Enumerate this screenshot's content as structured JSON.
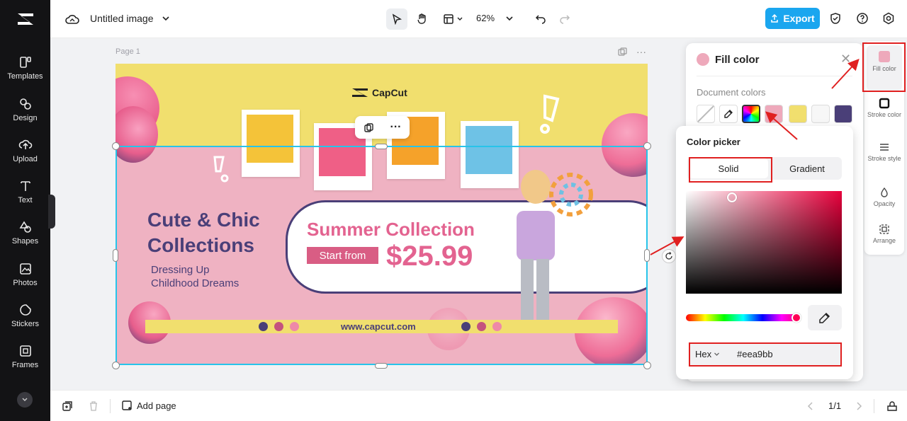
{
  "app": {
    "doc_title": "Untitled image",
    "zoom": "62%",
    "export_label": "Export",
    "add_page_label": "Add page",
    "page_count": "1/1",
    "page_label": "Page 1"
  },
  "sidebar": {
    "items": [
      {
        "label": "Templates",
        "icon": "templates-icon"
      },
      {
        "label": "Design",
        "icon": "design-icon"
      },
      {
        "label": "Upload",
        "icon": "upload-icon"
      },
      {
        "label": "Text",
        "icon": "text-icon"
      },
      {
        "label": "Shapes",
        "icon": "shapes-icon"
      },
      {
        "label": "Photos",
        "icon": "photos-icon"
      },
      {
        "label": "Stickers",
        "icon": "stickers-icon"
      },
      {
        "label": "Frames",
        "icon": "frames-icon"
      }
    ]
  },
  "design": {
    "brand": "CapCut",
    "title_line1": "Cute & Chic",
    "title_line2": "Collections",
    "sub_line1": "Dressing Up",
    "sub_line2": "Childhood Dreams",
    "summer_title": "Summer Collection",
    "start_from": "Start from",
    "price": "$25.99",
    "url": "www.capcut.com"
  },
  "right_rail": {
    "items": [
      {
        "label": "Fill color",
        "icon": "fill-color-icon"
      },
      {
        "label": "Stroke color",
        "icon": "stroke-color-icon"
      },
      {
        "label": "Stroke style",
        "icon": "stroke-style-icon"
      },
      {
        "label": "Opacity",
        "icon": "opacity-icon"
      },
      {
        "label": "Arrange",
        "icon": "arrange-icon"
      }
    ]
  },
  "fill_panel": {
    "title": "Fill color",
    "doc_colors_label": "Document colors",
    "swatches": [
      "transparent",
      "eyedropper",
      "multicolor",
      "#eea9bb",
      "#f1df6e",
      "#f7f7f7",
      "#4a3f78"
    ]
  },
  "picker": {
    "title": "Color picker",
    "solid_label": "Solid",
    "gradient_label": "Gradient",
    "hex_mode": "Hex",
    "hex_value": "#eea9bb"
  },
  "colors": {
    "accent": "#1aa6ef",
    "selection": "#27c4ea",
    "highlight": "#e02020",
    "fill": "#eea9bb"
  }
}
